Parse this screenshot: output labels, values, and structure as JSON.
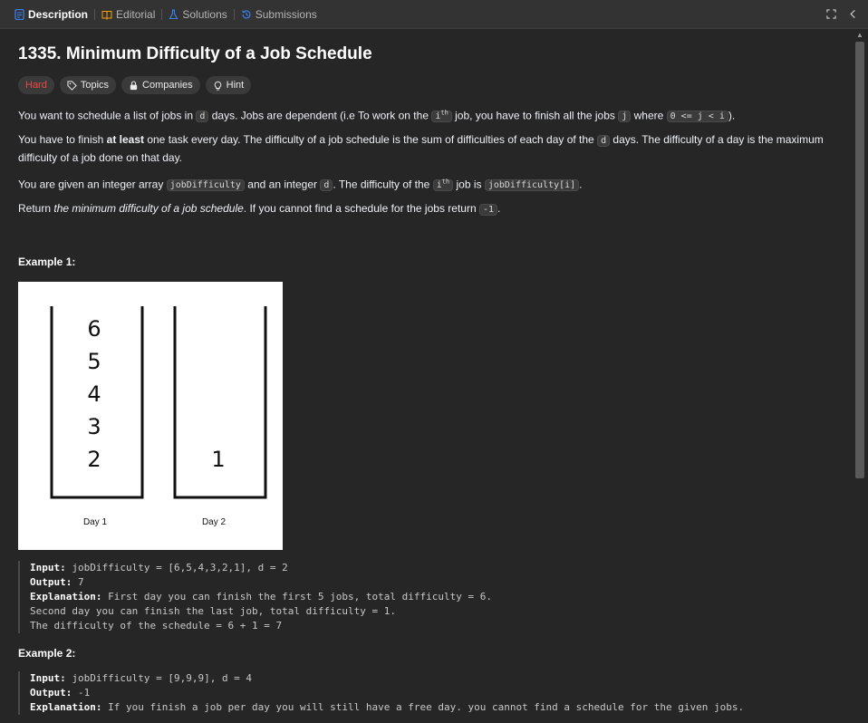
{
  "tabs": [
    {
      "label": "Description",
      "icon": "description-icon",
      "active": true
    },
    {
      "label": "Editorial",
      "icon": "book-icon",
      "active": false
    },
    {
      "label": "Solutions",
      "icon": "flask-icon",
      "active": false
    },
    {
      "label": "Submissions",
      "icon": "history-icon",
      "active": false
    }
  ],
  "tabbar_actions": {
    "maximize_icon": "maximize-icon",
    "collapse_icon": "chevron-left-icon"
  },
  "problem": {
    "title": "1335. Minimum Difficulty of a Job Schedule",
    "difficulty": "Hard",
    "difficulty_color": "#ef4743",
    "tags": {
      "topics": "Topics",
      "companies": "Companies",
      "hint": "Hint"
    }
  },
  "description": {
    "p1": {
      "a": "You want to schedule a list of jobs in ",
      "d": "d",
      "b": " days. Jobs are dependent (i.e To work on the ",
      "i": "i",
      "th": "th",
      "c": " job, you have to finish all the jobs ",
      "j": "j",
      "e": " where ",
      "cond": "0 <= j < i",
      "f": ")."
    },
    "p2": {
      "a": "You have to finish ",
      "bold": "at least",
      "b": " one task every day. The difficulty of a job schedule is the sum of difficulties of each day of the ",
      "d": "d",
      "c": " days. The difficulty of a day is the maximum difficulty of a job done on that day."
    },
    "p3": {
      "a": "You are given an integer array ",
      "arr": "jobDifficulty",
      "b": " and an integer ",
      "d": "d",
      "c": ". The difficulty of the ",
      "i": "i",
      "th": "th",
      "e": " job is ",
      "expr": "jobDifficulty[i]",
      "f": "."
    },
    "p4": {
      "a": "Return ",
      "em": "the minimum difficulty of a job schedule",
      "b": ". If you cannot find a schedule for the jobs return ",
      "neg": "-1",
      "c": "."
    }
  },
  "example1": {
    "heading": "Example 1:",
    "diagram": {
      "day1_jobs": [
        "6",
        "5",
        "4",
        "3",
        "2"
      ],
      "day2_jobs": [
        "1"
      ],
      "day1_label": "Day 1",
      "day2_label": "Day 2"
    },
    "input_label": "Input:",
    "input": "jobDifficulty = [6,5,4,3,2,1], d = 2",
    "output_label": "Output:",
    "output": "7",
    "explanation_label": "Explanation:",
    "explanation_lines": [
      "First day you can finish the first 5 jobs, total difficulty = 6.",
      "Second day you can finish the last job, total difficulty = 1.",
      "The difficulty of the schedule = 6 + 1 = 7"
    ]
  },
  "example2": {
    "heading": "Example 2:",
    "input_label": "Input:",
    "input": "jobDifficulty = [9,9,9], d = 4",
    "output_label": "Output:",
    "output": "-1",
    "explanation_label": "Explanation:",
    "explanation": "If you finish a job per day you will still have a free day. you cannot find a schedule for the given jobs."
  },
  "colors": {
    "background": "#262626",
    "tabbar": "#333333",
    "accent": "#3b82f6",
    "hard": "#ef4743"
  }
}
